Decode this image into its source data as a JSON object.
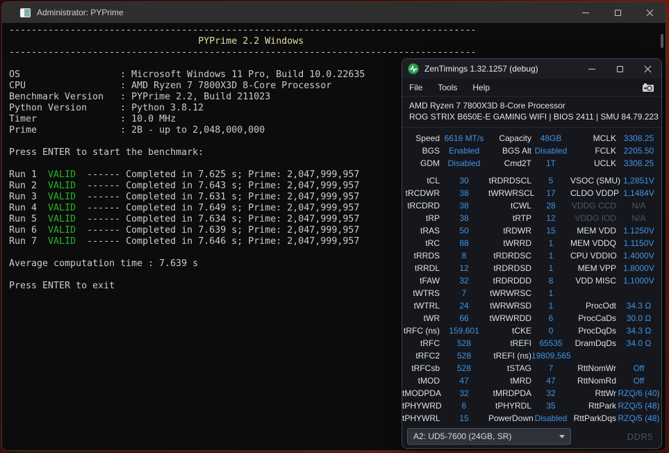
{
  "colors": {
    "value_blue": "#4095e5",
    "valid_green": "#27b427",
    "banner_yellow": "#e6dfa5",
    "dim_gray": "#4e5866",
    "memtype_gray": "#4d525c"
  },
  "terminal": {
    "titlebar": {
      "title": "Administrator: PYPrime"
    },
    "lines": [
      {
        "s": [
          [
            "------------------------------------------------------------------------------------",
            ""
          ]
        ]
      },
      {
        "s": [
          [
            "                                  ",
            ""
          ],
          [
            "PYPrime 2.2 Windows",
            "banner"
          ]
        ]
      },
      {
        "s": [
          [
            "------------------------------------------------------------------------------------",
            ""
          ]
        ]
      },
      {
        "s": []
      },
      {
        "s": [
          [
            "OS                  : Microsoft Windows 11 Pro, Build 10.0.22635",
            ""
          ]
        ]
      },
      {
        "s": [
          [
            "CPU                 : AMD Ryzen 7 7800X3D 8-Core Processor",
            ""
          ]
        ]
      },
      {
        "s": [
          [
            "Benchmark Version   : PYPrime 2.2, Build 211023",
            ""
          ]
        ]
      },
      {
        "s": [
          [
            "Python Version      : Python 3.8.12",
            ""
          ]
        ]
      },
      {
        "s": [
          [
            "Timer               : 10.0 MHz",
            ""
          ]
        ]
      },
      {
        "s": [
          [
            "Prime               : 2B - up to 2,048,000,000",
            ""
          ]
        ]
      },
      {
        "s": []
      },
      {
        "s": [
          [
            "Press ENTER to start the benchmark:",
            ""
          ]
        ]
      },
      {
        "s": []
      },
      {
        "s": [
          [
            "Run 1  ",
            ""
          ],
          [
            "VALID",
            "green"
          ],
          [
            "  ------ Completed in 7.625 s; Prime: 2,047,999,957",
            ""
          ]
        ]
      },
      {
        "s": [
          [
            "Run 2  ",
            ""
          ],
          [
            "VALID",
            "green"
          ],
          [
            "  ------ Completed in 7.643 s; Prime: 2,047,999,957",
            ""
          ]
        ]
      },
      {
        "s": [
          [
            "Run 3  ",
            ""
          ],
          [
            "VALID",
            "green"
          ],
          [
            "  ------ Completed in 7.631 s; Prime: 2,047,999,957",
            ""
          ]
        ]
      },
      {
        "s": [
          [
            "Run 4  ",
            ""
          ],
          [
            "VALID",
            "green"
          ],
          [
            "  ------ Completed in 7.649 s; Prime: 2,047,999,957",
            ""
          ]
        ]
      },
      {
        "s": [
          [
            "Run 5  ",
            ""
          ],
          [
            "VALID",
            "green"
          ],
          [
            "  ------ Completed in 7.634 s; Prime: 2,047,999,957",
            ""
          ]
        ]
      },
      {
        "s": [
          [
            "Run 6  ",
            ""
          ],
          [
            "VALID",
            "green"
          ],
          [
            "  ------ Completed in 7.639 s; Prime: 2,047,999,957",
            ""
          ]
        ]
      },
      {
        "s": [
          [
            "Run 7  ",
            ""
          ],
          [
            "VALID",
            "green"
          ],
          [
            "  ------ Completed in 7.646 s; Prime: 2,047,999,957",
            ""
          ]
        ]
      },
      {
        "s": []
      },
      {
        "s": [
          [
            "Average computation time : 7.639 s",
            ""
          ]
        ]
      },
      {
        "s": []
      },
      {
        "s": [
          [
            "Press ENTER to exit",
            ""
          ]
        ]
      }
    ]
  },
  "zentimings": {
    "titlebar": {
      "title": "ZenTimings 1.32.1257 (debug)"
    },
    "menu": {
      "items": [
        "File",
        "Tools",
        "Help"
      ]
    },
    "system": {
      "cpu": "AMD Ryzen 7 7800X3D 8-Core Processor",
      "board": "ROG STRIX B650E-E GAMING WIFI | BIOS 2411 | SMU 84.79.223"
    },
    "top_rows": [
      [
        [
          "Speed",
          "6616 MT/s"
        ],
        [
          "Capacity",
          "48GB"
        ],
        [
          "MCLK",
          "3308.25"
        ]
      ],
      [
        [
          "BGS",
          "Enabled"
        ],
        [
          "BGS Alt",
          "Disabled"
        ],
        [
          "FCLK",
          "2205.50"
        ]
      ],
      [
        [
          "GDM",
          "Disabled"
        ],
        [
          "Cmd2T",
          "1T"
        ],
        [
          "UCLK",
          "3308.25"
        ]
      ]
    ],
    "timing_rows": [
      [
        [
          "tCL",
          "30"
        ],
        [
          "tRDRDSCL",
          "5"
        ],
        [
          "VSOC (SMU)",
          "1,2851V"
        ]
      ],
      [
        [
          "tRCDWR",
          "38"
        ],
        [
          "tWRWRSCL",
          "17"
        ],
        [
          "CLDO VDDP",
          "1,1484V"
        ]
      ],
      [
        [
          "tRCDRD",
          "38"
        ],
        [
          "tCWL",
          "28"
        ],
        [
          "VDDG CCD",
          "N/A",
          "dim"
        ]
      ],
      [
        [
          "tRP",
          "38"
        ],
        [
          "tRTP",
          "12"
        ],
        [
          "VDDG IOD",
          "N/A",
          "dim"
        ]
      ],
      [
        [
          "tRAS",
          "50"
        ],
        [
          "tRDWR",
          "15"
        ],
        [
          "MEM VDD",
          "1.1250V"
        ]
      ],
      [
        [
          "tRC",
          "88"
        ],
        [
          "tWRRD",
          "1"
        ],
        [
          "MEM VDDQ",
          "1.1150V"
        ]
      ],
      [
        [
          "tRRDS",
          "8"
        ],
        [
          "tRDRDSC",
          "1"
        ],
        [
          "CPU VDDIO",
          "1.4000V"
        ]
      ],
      [
        [
          "tRRDL",
          "12"
        ],
        [
          "tRDRDSD",
          "1"
        ],
        [
          "MEM VPP",
          "1.8000V"
        ]
      ],
      [
        [
          "tFAW",
          "32"
        ],
        [
          "tRDRDDD",
          "8"
        ],
        [
          "VDD MISC",
          "1,1000V"
        ]
      ],
      [
        [
          "tWTRS",
          "7"
        ],
        [
          "tWRWRSC",
          "1"
        ],
        null
      ],
      [
        [
          "tWTRL",
          "24"
        ],
        [
          "tWRWRSD",
          "1"
        ],
        [
          "ProcOdt",
          "34.3 Ω"
        ]
      ],
      [
        [
          "tWR",
          "66"
        ],
        [
          "tWRWRDD",
          "6"
        ],
        [
          "ProcCaDs",
          "30.0 Ω"
        ]
      ],
      [
        [
          "tRFC (ns)",
          "159,601"
        ],
        [
          "tCKE",
          "0"
        ],
        [
          "ProcDqDs",
          "34.3 Ω"
        ]
      ],
      [
        [
          "tRFC",
          "528"
        ],
        [
          "tREFI",
          "65535"
        ],
        [
          "DramDqDs",
          "34.0 Ω"
        ]
      ],
      [
        [
          "tRFC2",
          "528"
        ],
        [
          "tREFI (ns)",
          "19809,565"
        ],
        null
      ],
      [
        [
          "tRFCsb",
          "528"
        ],
        [
          "tSTAG",
          "7"
        ],
        [
          "RttNomWr",
          "Off"
        ]
      ],
      [
        [
          "tMOD",
          "47"
        ],
        [
          "tMRD",
          "47"
        ],
        [
          "RttNomRd",
          "Off"
        ]
      ],
      [
        [
          "tMODPDA",
          "32"
        ],
        [
          "tMRDPDA",
          "32"
        ],
        [
          "RttWr",
          "RZQ/6 (40)"
        ]
      ],
      [
        [
          "tPHYWRD",
          "6"
        ],
        [
          "tPHYRDL",
          "35"
        ],
        [
          "RttPark",
          "RZQ/5 (48)"
        ]
      ],
      [
        [
          "tPHYWRL",
          "15"
        ],
        [
          "PowerDown",
          "Disabled"
        ],
        [
          "RttParkDqs",
          "RZQ/5 (48)"
        ]
      ]
    ],
    "footer": {
      "dimm": "A2: UD5-7600 (24GB, SR)",
      "memory_type": "DDR5"
    }
  }
}
